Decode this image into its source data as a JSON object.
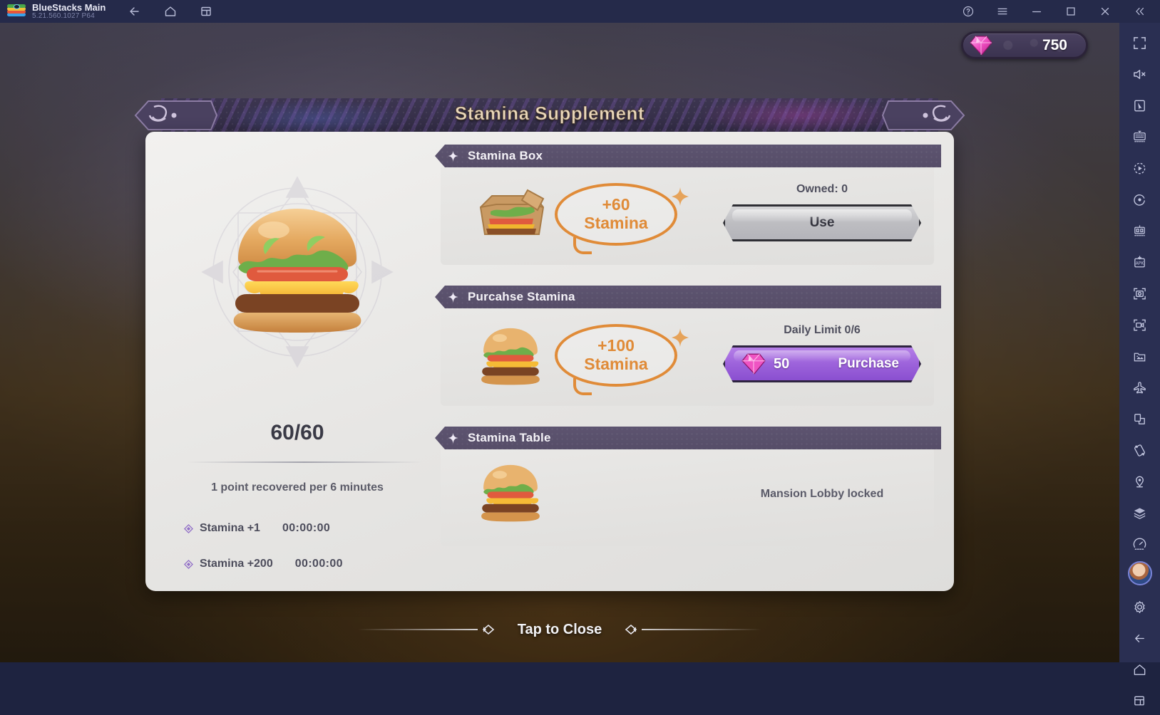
{
  "titlebar": {
    "app_name": "BlueStacks Main",
    "version": "5.21.560.1027  P64",
    "logo_icon": "bluestacks-logo-icon",
    "nav": [
      {
        "name": "back",
        "icon": "arrow-left-icon"
      },
      {
        "name": "home",
        "icon": "home-icon"
      },
      {
        "name": "multi-instance",
        "icon": "windows-stack-icon"
      }
    ],
    "window_controls": [
      {
        "name": "help",
        "icon": "question-circle-icon"
      },
      {
        "name": "menu",
        "icon": "hamburger-menu-icon"
      },
      {
        "name": "minimize",
        "icon": "minimize-icon"
      },
      {
        "name": "maximize",
        "icon": "maximize-icon"
      },
      {
        "name": "close",
        "icon": "close-icon"
      },
      {
        "name": "collapse-sidebar",
        "icon": "double-chevron-left-icon"
      }
    ]
  },
  "currency": {
    "gem_icon": "gem-icon",
    "amount": "750"
  },
  "dialog": {
    "title": "Stamina Supplement",
    "left_panel": {
      "item_icon": "burger-icon",
      "mandala_icon": "mandala-ornament-icon",
      "stamina_value": "60/60",
      "recovery_note": "1 point recovered per 6 minutes",
      "timers": [
        {
          "icon": "diamond-icon",
          "label": "Stamina +1",
          "time": "00:00:00"
        },
        {
          "icon": "diamond-icon",
          "label": "Stamina +200",
          "time": "00:00:00"
        }
      ]
    },
    "sections": [
      {
        "id": "stamina-box",
        "header": "Stamina Box",
        "header_icon": "sparkle-icon",
        "item_icon": "lunch-box-icon",
        "bubble_amount": "+60",
        "bubble_unit": "Stamina",
        "status_label": "Owned: 0",
        "button_label": "Use",
        "button_type": "grey"
      },
      {
        "id": "purchase-stamina",
        "header": "Purcahse Stamina",
        "header_icon": "sparkle-icon",
        "item_icon": "burger-icon",
        "bubble_amount": "+100",
        "bubble_unit": "Stamina",
        "status_label": "Daily Limit 0/6",
        "price": "50",
        "price_icon": "gem-icon",
        "button_label": "Purchase",
        "button_type": "purple"
      },
      {
        "id": "stamina-table",
        "header": "Stamina Table",
        "header_icon": "sparkle-icon",
        "item_icon": "burger-icon",
        "status_label": "Mansion Lobby locked"
      }
    ]
  },
  "footer": {
    "tap_to_close": "Tap to Close",
    "marker_icon": "diamond-marker-icon"
  },
  "sidebar": {
    "items": [
      {
        "name": "fullscreen",
        "icon": "fullscreen-icon"
      },
      {
        "name": "mute",
        "icon": "speaker-mute-icon"
      },
      {
        "name": "game-controls",
        "icon": "cursor-pointer-icon"
      },
      {
        "name": "keyboard-controls",
        "icon": "keyboard-icon"
      },
      {
        "name": "macro-recorder",
        "icon": "play-record-icon"
      },
      {
        "name": "script",
        "icon": "script-dot-icon"
      },
      {
        "name": "multi-instance-manager",
        "icon": "instance-manager-icon"
      },
      {
        "name": "install-apk",
        "icon": "apk-plus-icon"
      },
      {
        "name": "screenshot",
        "icon": "camera-icon"
      },
      {
        "name": "screen-record",
        "icon": "video-record-icon"
      },
      {
        "name": "media-manager",
        "icon": "media-folder-icon"
      },
      {
        "name": "eco-mode",
        "icon": "airplane-icon"
      },
      {
        "name": "resize-window",
        "icon": "resize-icon"
      },
      {
        "name": "rotate",
        "icon": "rotate-device-icon"
      },
      {
        "name": "location",
        "icon": "location-pin-icon"
      },
      {
        "name": "layers",
        "icon": "layers-icon"
      },
      {
        "name": "performance",
        "icon": "speedometer-icon"
      }
    ],
    "bottom_items": [
      {
        "name": "user-avatar",
        "icon": "avatar-icon"
      },
      {
        "name": "settings",
        "icon": "gear-icon"
      },
      {
        "name": "back",
        "icon": "arrow-left-icon"
      },
      {
        "name": "home",
        "icon": "home-icon"
      },
      {
        "name": "recents",
        "icon": "windows-stack-icon"
      }
    ]
  }
}
